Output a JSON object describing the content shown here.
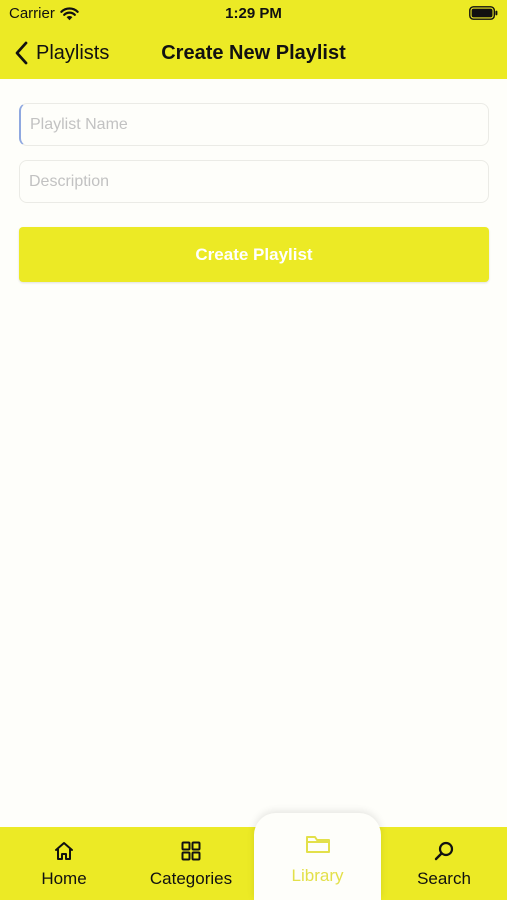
{
  "status_bar": {
    "carrier": "Carrier",
    "time": "1:29 PM"
  },
  "nav": {
    "back_label": "Playlists",
    "title": "Create New Playlist"
  },
  "form": {
    "name_placeholder": "Playlist Name",
    "name_value": "",
    "description_placeholder": "Description",
    "description_value": "",
    "submit_label": "Create Playlist"
  },
  "tabs": [
    {
      "label": "Home",
      "icon": "house-icon"
    },
    {
      "label": "Categories",
      "icon": "grid-icon"
    },
    {
      "label": "Library",
      "icon": "folder-icon",
      "selected": true
    },
    {
      "label": "Search",
      "icon": "magnifier-icon"
    }
  ],
  "colors": {
    "accent": "#ecea25",
    "background": "#fefefa",
    "selected_tab_text": "#e3e04a",
    "placeholder": "#c2c2c2"
  }
}
